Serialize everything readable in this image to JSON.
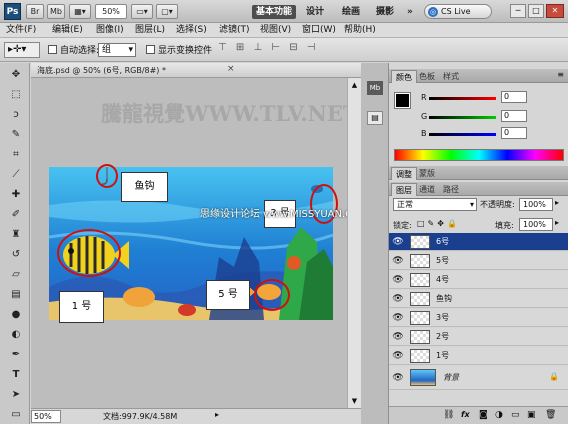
{
  "titlebar": {
    "app_logo": "Ps",
    "btn_br": "Br",
    "btn_mb": "Mb",
    "zoom": "50%",
    "workspaces": [
      "基本功能",
      "设计",
      "绘画",
      "摄影"
    ],
    "more": "»",
    "cs_live": "CS Live",
    "window_controls": [
      "─",
      "□",
      "✕"
    ]
  },
  "menus": [
    "文件(F)",
    "编辑(E)",
    "图像(I)",
    "图层(L)",
    "选择(S)",
    "滤镜(T)",
    "视图(V)",
    "窗口(W)",
    "帮助(H)"
  ],
  "options": {
    "auto_select_label": "自动选择:",
    "auto_select_value": "组",
    "show_transform_label": "显示变换控件"
  },
  "document": {
    "tab_title": "海底.psd @ 50% (6号, RGB/8#) *",
    "tab_close": "×",
    "watermark": "騰龍視覺WWW.TLV.NET",
    "watermark2": "思缘设计论坛 www.MISSYUAN.COM",
    "labels": {
      "fish_hook": "鱼钩",
      "no1": "1 号",
      "no3": "3 号",
      "no5": "5 号"
    },
    "zoom_status": "50%",
    "doc_info": "文档:997.9K/4.58M"
  },
  "color_panel": {
    "tabs": [
      "颜色",
      "色板",
      "样式"
    ],
    "channels": [
      {
        "label": "R",
        "value": "0"
      },
      {
        "label": "G",
        "value": "0"
      },
      {
        "label": "B",
        "value": "0"
      }
    ]
  },
  "adjust_panel": {
    "tabs": [
      "调整",
      "蒙版"
    ]
  },
  "layers_panel": {
    "tabs": [
      "图层",
      "通道",
      "路径"
    ],
    "blend_mode": "正常",
    "opacity_label": "不透明度:",
    "opacity_value": "100%",
    "lock_label": "锁定:",
    "fill_label": "填充:",
    "fill_value": "100%",
    "layers": [
      "6号",
      "5号",
      "4号",
      "鱼钩",
      "3号",
      "2号",
      "1号",
      "背景"
    ],
    "selected": "6号",
    "bottom_icons": [
      "link-icon",
      "fx-icon",
      "mask-icon",
      "adjustment-icon",
      "group-icon",
      "new-layer-icon",
      "trash-icon"
    ]
  },
  "colors": {
    "accent_selected_layer": "#1a3f8f",
    "annotation_red": "#d01010"
  }
}
